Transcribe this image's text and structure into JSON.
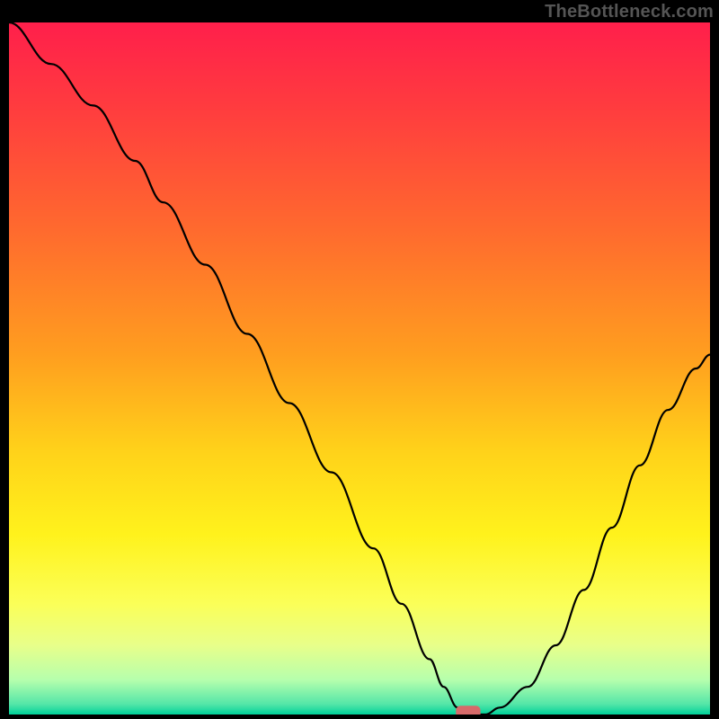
{
  "watermark": "TheBottleneck.com",
  "colors": {
    "frame_bg": "#000000",
    "curve": "#000000",
    "marker": "#d76a6a",
    "gradient_stops": [
      {
        "offset": 0.0,
        "color": "#ff1f4b"
      },
      {
        "offset": 0.12,
        "color": "#ff3b3f"
      },
      {
        "offset": 0.3,
        "color": "#ff6a2e"
      },
      {
        "offset": 0.48,
        "color": "#ff9e1f"
      },
      {
        "offset": 0.62,
        "color": "#ffd21a"
      },
      {
        "offset": 0.74,
        "color": "#fff21c"
      },
      {
        "offset": 0.84,
        "color": "#fbff58"
      },
      {
        "offset": 0.9,
        "color": "#e8ff8a"
      },
      {
        "offset": 0.95,
        "color": "#b6ffad"
      },
      {
        "offset": 0.985,
        "color": "#54e6a8"
      },
      {
        "offset": 1.0,
        "color": "#00d19a"
      }
    ]
  },
  "chart_data": {
    "type": "line",
    "title": "",
    "xlabel": "",
    "ylabel": "",
    "xlim": [
      0,
      100
    ],
    "ylim": [
      0,
      100
    ],
    "grid": false,
    "legend": false,
    "series": [
      {
        "name": "bottleneck-curve",
        "x": [
          0,
          6,
          12,
          18,
          22,
          28,
          34,
          40,
          46,
          52,
          56,
          60,
          62,
          64,
          66,
          68,
          70,
          74,
          78,
          82,
          86,
          90,
          94,
          98,
          100
        ],
        "y": [
          100,
          94,
          88,
          80,
          74,
          65,
          55,
          45,
          35,
          24,
          16,
          8,
          4,
          1,
          0,
          0,
          1,
          4,
          10,
          18,
          27,
          36,
          44,
          50,
          52
        ]
      }
    ],
    "marker": {
      "x": 65.5,
      "y": 0,
      "width": 3.5,
      "height": 2
    },
    "notes": "y is normalized 0–100 (0 = bottom green band, 100 = top red). x is normalized 0–100 left→right. Values estimated from pixel positions; chart has no axes or tick labels."
  }
}
